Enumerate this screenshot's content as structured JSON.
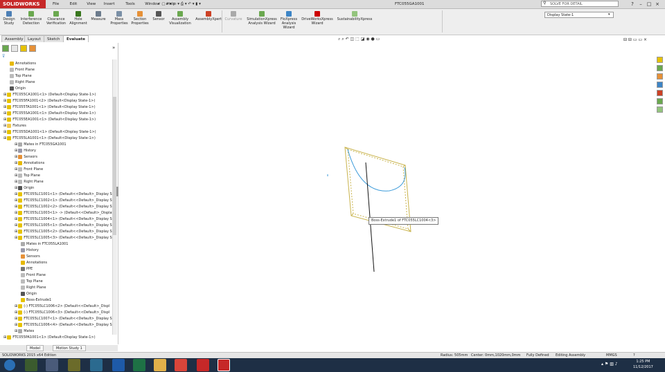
{
  "app": {
    "brand": "SOLIDWORKS",
    "menu": [
      "File",
      "Edit",
      "View",
      "Insert",
      "Tools",
      "Window",
      "Help"
    ],
    "document_title": "FTC055GA1001",
    "search_placeholder": "SOLVE FOR DETAIL",
    "win_buttons": [
      "?",
      "–",
      "□",
      "×"
    ]
  },
  "commands": {
    "tools": [
      {
        "label": "Design Study",
        "color": "#4d7fb5"
      },
      {
        "label": "Interference Detection",
        "color": "#6aa84f"
      },
      {
        "label": "Clearance Verification",
        "color": "#6aa84f"
      },
      {
        "label": "Hole Alignment",
        "color": "#38761d"
      },
      {
        "label": "Measure",
        "color": "#6b7b8c"
      },
      {
        "label": "Mass Properties",
        "color": "#7a8fa6"
      },
      {
        "label": "Section Properties",
        "color": "#e69138"
      },
      {
        "label": "Sensor",
        "color": "#555555"
      },
      {
        "label": "Assembly Visualization",
        "color": "#6aa84f"
      },
      {
        "label": "AssemblyXpert",
        "color": "#cc4125"
      },
      {
        "label": "Curvature",
        "color": "#aaaaaa"
      },
      {
        "label": "SimulationXpress Analysis Wizard",
        "color": "#6aa84f"
      },
      {
        "label": "FloXpress Analysis Wizard",
        "color": "#3d85c6"
      },
      {
        "label": "DriveWorksXpress Wizard",
        "color": "#cc0000"
      },
      {
        "label": "SustainabilityXpress",
        "color": "#93c47d"
      }
    ],
    "configuration": "Display State-1"
  },
  "command_tabs": [
    "Assembly",
    "Layout",
    "Sketch",
    "Evaluate"
  ],
  "active_tab": "Evaluate",
  "tree": [
    {
      "label": "Annotations",
      "indent": 1,
      "icon": "#e6b800"
    },
    {
      "label": "Front Plane",
      "indent": 1,
      "icon": "#bbbbbb"
    },
    {
      "label": "Top Plane",
      "indent": 1,
      "icon": "#bbbbbb"
    },
    {
      "label": "Right Plane",
      "indent": 1,
      "icon": "#bbbbbb"
    },
    {
      "label": "Origin",
      "indent": 1,
      "icon": "#555555"
    },
    {
      "label": "FTC055CA1001<1> (Default<Display State-1>)",
      "indent": 0,
      "icon": "#e6c200"
    },
    {
      "label": "FTC055FA1001<2> (Default<Display State-1>)",
      "indent": 0,
      "icon": "#e6c200"
    },
    {
      "label": "FTC055TA1001<1> (Default<Display State-1>)",
      "indent": 0,
      "icon": "#e6c200"
    },
    {
      "label": "FTC055SA1001<1> (Default<Display State-1>)",
      "indent": 0,
      "icon": "#e6c200"
    },
    {
      "label": "FTC055EA1001<1> (Default<Display State-1>)",
      "indent": 0,
      "icon": "#e6c200"
    },
    {
      "label": "Fixtures",
      "indent": 0,
      "icon": "#f2c94c"
    },
    {
      "label": "FTC055DA1001<1> (Default<Display State-1>)",
      "indent": 0,
      "icon": "#e6c200"
    },
    {
      "label": "FTC055LA1001<1> (Default<Display State-1>)",
      "indent": 0,
      "icon": "#e6c200"
    },
    {
      "label": "Mates in FTC055GA1001",
      "indent": 2,
      "icon": "#aaaaaa"
    },
    {
      "label": "History",
      "indent": 2,
      "icon": "#9999aa"
    },
    {
      "label": "Sensors",
      "indent": 2,
      "icon": "#e69138"
    },
    {
      "label": "Annotations",
      "indent": 2,
      "icon": "#e6b800"
    },
    {
      "label": "Front Plane",
      "indent": 2,
      "icon": "#bbbbbb"
    },
    {
      "label": "Top Plane",
      "indent": 2,
      "icon": "#bbbbbb"
    },
    {
      "label": "Right Plane",
      "indent": 2,
      "icon": "#bbbbbb"
    },
    {
      "label": "Origin",
      "indent": 2,
      "icon": "#555555"
    },
    {
      "label": "FTC055LC1001<1> (Default<<Default>_Display St",
      "indent": 2,
      "icon": "#e6c200"
    },
    {
      "label": "FTC055LC1002<1> (Default<<Default>_Display St",
      "indent": 2,
      "icon": "#e6c200"
    },
    {
      "label": "FTC055LC1002<2> (Default<<Default>_Display St",
      "indent": 2,
      "icon": "#e6c200"
    },
    {
      "label": "FTC055LC1003<1> -> (Default<<Default>_Display",
      "indent": 2,
      "icon": "#e6c200"
    },
    {
      "label": "FTC055LC1004<1> (Default<<Default>_Display St",
      "indent": 2,
      "icon": "#e6c200"
    },
    {
      "label": "FTC055LC1005<1> (Default<<Default>_Display St",
      "indent": 2,
      "icon": "#e6c200"
    },
    {
      "label": "FTC055LC1005<2> (Default<<Default>_Display St",
      "indent": 2,
      "icon": "#e6c200"
    },
    {
      "label": "FTC055LC1005<3> (Default<<Default>_Display St",
      "indent": 2,
      "icon": "#e6c200"
    },
    {
      "label": "Mates in FTC055LA1001",
      "indent": 3,
      "icon": "#aaaaaa"
    },
    {
      "label": "History",
      "indent": 3,
      "icon": "#9999aa"
    },
    {
      "label": "Sensors",
      "indent": 3,
      "icon": "#e69138"
    },
    {
      "label": "Annotations",
      "indent": 3,
      "icon": "#e6b800"
    },
    {
      "label": "PPE",
      "indent": 3,
      "icon": "#777777"
    },
    {
      "label": "Front Plane",
      "indent": 3,
      "icon": "#bbbbbb"
    },
    {
      "label": "Top Plane",
      "indent": 3,
      "icon": "#bbbbbb"
    },
    {
      "label": "Right Plane",
      "indent": 3,
      "icon": "#bbbbbb"
    },
    {
      "label": "Origin",
      "indent": 3,
      "icon": "#555555"
    },
    {
      "label": "Boss-Extrude1",
      "indent": 3,
      "icon": "#e6c200"
    },
    {
      "label": "(-) FTC055LC1006<2> (Default<<Default>_Displ",
      "indent": 2,
      "icon": "#e6c200"
    },
    {
      "label": "(-) FTC055LC1006<3> (Default<<Default>_Displ",
      "indent": 2,
      "icon": "#e6c200"
    },
    {
      "label": "FTC055LC1007<1> (Default<<Default>_Display S",
      "indent": 2,
      "icon": "#e6c200"
    },
    {
      "label": "FTC055LC1006<4> (Default<<Default>_Display S",
      "indent": 2,
      "icon": "#e6c200"
    },
    {
      "label": "Mates",
      "indent": 2,
      "icon": "#aaaaaa"
    },
    {
      "label": "FTC055PA1001<1> (Default<Display State-1>)",
      "indent": 0,
      "icon": "#e6c200"
    }
  ],
  "bottom_tabs": [
    "Model",
    "Motion Study 1"
  ],
  "viewport": {
    "tooltip": "Boss-Extrude1 of FTC055LC1004<3>"
  },
  "status": {
    "edition": "SOLIDWORKS 2015 x64 Edition",
    "radius": "Radius: 505mm",
    "center": "Center: 0mm,1020mm,0mm",
    "defined": "Fully Defined",
    "mode": "Editing Assembly",
    "units": "MMGS"
  },
  "taskbar": {
    "time": "1:25 PM",
    "date": "11/12/2017"
  },
  "colors": {
    "accent": "#c62828",
    "arc": "#3a9ad9",
    "model_outline": "#c8b24a"
  }
}
